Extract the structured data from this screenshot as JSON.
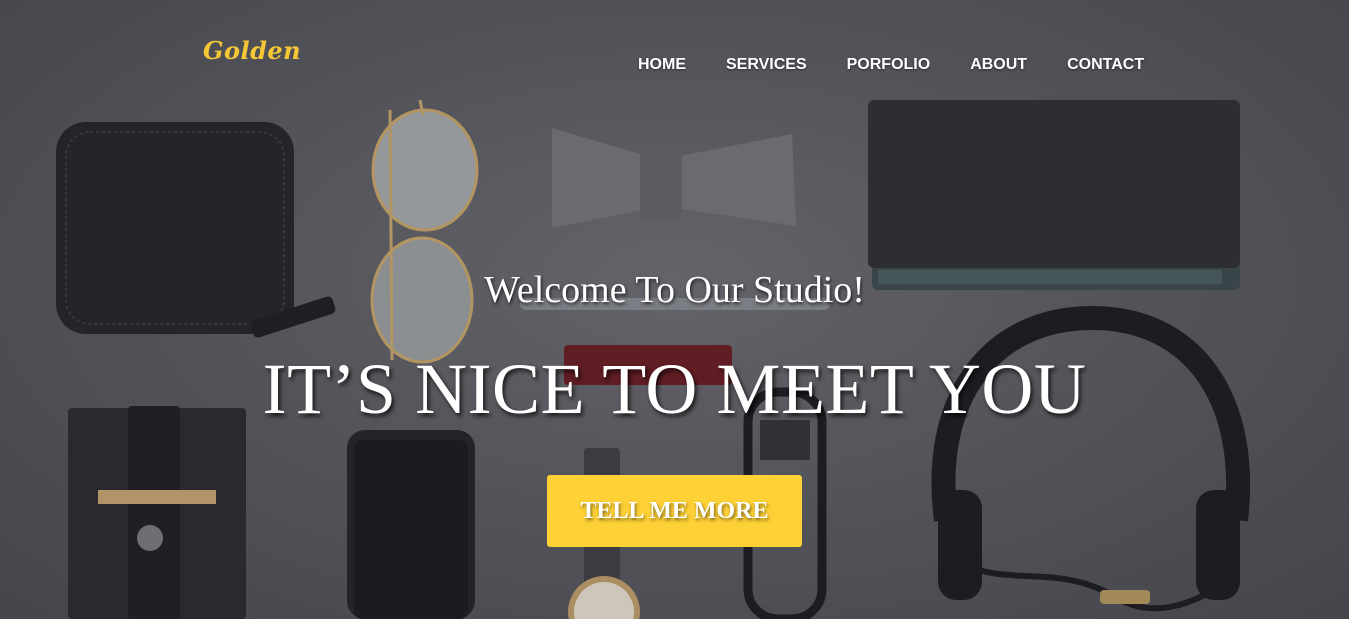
{
  "brand": {
    "logo_text": "Golden",
    "logo_color": "#f5c736"
  },
  "nav": {
    "items": [
      {
        "label": "HOME"
      },
      {
        "label": "SERVICES"
      },
      {
        "label": "PORFOLIO"
      },
      {
        "label": "ABOUT"
      },
      {
        "label": "CONTACT"
      }
    ]
  },
  "hero": {
    "subheading": "Welcome To Our Studio!",
    "heading": "IT’S NICE TO MEET YOU",
    "cta_label": "TELL ME MORE",
    "cta_color": "#fed136",
    "background_description_icons": [
      "wallet-icon",
      "sunglasses-icon",
      "bow-tie-icon",
      "notebook-icon",
      "pen-icon",
      "card-holder-icon",
      "smartphone-icon",
      "wristwatch-icon",
      "eyeglasses-icon",
      "headphones-icon"
    ]
  }
}
